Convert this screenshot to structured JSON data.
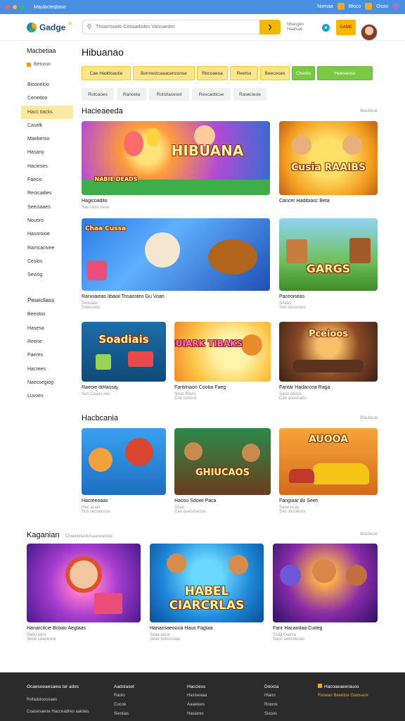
{
  "window": {
    "title": "Maulacteqtaso",
    "controls": [
      "Nomaa",
      "Bloco",
      "Osoo"
    ]
  },
  "header": {
    "logo": "Gadge",
    "logo_sup": "®",
    "search_placeholder": "Thoarroiads Cetaiadsiles Vansaeder",
    "help_lines": [
      "Nbacgeo",
      "Haatsae"
    ],
    "promo": "GAME"
  },
  "sidebar": {
    "head": "Macbetiaa",
    "recent": "Benzoo",
    "items": [
      "Biconeloo",
      "Cenedoo",
      "Hacc tiacks",
      "Caselk",
      "Maeberoo",
      "Hasany",
      "Hacieses",
      "Faecis",
      "Reoicadies",
      "Seeciaaes",
      "Nouoro",
      "Hasoroioe",
      "Ramcacivee",
      "Ceslos",
      "Seviog"
    ],
    "active_index": 2,
    "sub_head": "Pesecliass",
    "sub_items": [
      "Beeotos",
      "Hasesa",
      "Reene",
      "Paeres",
      "Hacrees",
      "Naecsegiog",
      "Luvoes"
    ]
  },
  "main": {
    "title": "Hibuanao",
    "chips": [
      "Cae Haddoaotie",
      "Bonnestcaaacenconse",
      "Rbcoaeoa",
      "Reetsa",
      "Beeceoes",
      "Cherbs",
      "Heleseoss"
    ],
    "tabs": [
      "Rotcaoes",
      "Ranceta",
      "Rotsitacesot",
      "Rescaoticse",
      "Rasecieoe"
    ],
    "sections": [
      {
        "title": "Hacieaeeda",
        "view_all": "Wasbeoe",
        "cards": [
          {
            "title": "Hagicoadlio",
            "meta": "Sax ceos cesa",
            "art": "HIBUANA",
            "art2": "NABIE DEADS"
          },
          {
            "title": "Cancer Hadibiasc Beta",
            "meta": "",
            "art": "Cusia RAAIBS"
          },
          {
            "title": "Ranioaieas libaoil Tosaosteo Gu Voan",
            "meta": "Sxocaas\nSxbocoos",
            "art": "Chaa Cussa"
          },
          {
            "title": "Paceoiseas",
            "meta": "Soaao\nSxo cesocoos",
            "art": "GARGS"
          },
          {
            "title": "Raeoie diHaosaj",
            "meta": "Sus Ceaos ees",
            "art": "Soadiais"
          },
          {
            "title": "Fantilnaon Cooba Faeg",
            "meta": "Sxoo Ravio\nCoo cosoos",
            "art": "GUIARK TIBAKS"
          },
          {
            "title": "Fantar Hadaccoa Raga",
            "meta": "Saoo ceoos\nCao aseocaos",
            "art": "Pceioos"
          }
        ]
      },
      {
        "title": "Hacbcania",
        "view_all": "Wasbeoe",
        "cards": [
          {
            "title": "Hacreeoaas",
            "meta": "Hec asias\nSus secoacoos",
            "art": ""
          },
          {
            "title": "Hacou Sdoiel Paca",
            "meta": "Soao\nCao aseoosecos",
            "art": "GHIUCAOS"
          },
          {
            "title": "Fangiaar do Seen",
            "meta": "Saoo ecas\nSxo socoecos",
            "art": "AUOOA"
          }
        ]
      },
      {
        "title": "Kaganian",
        "subtitle": "Cloaeioitauliosaaceaorae",
        "view_all": "Wasbeoe",
        "cards": [
          {
            "title": "Hanarcitcie Bcbao Aegtaas",
            "meta": "Sabo aeor\nSeoe saaoesoe",
            "art": ""
          },
          {
            "title": "Hanaosaeoooa Haus Fagtaa",
            "meta": "Sxaa aeca\nSeas sceccsoas",
            "art": "HABEL CIARCRLAS"
          },
          {
            "title": "Fanr Hacaodaa Cuiteg",
            "meta": "Sxaa Ooeca\nSaoo aeecoeoas",
            "art": ""
          }
        ]
      }
    ]
  },
  "footer": {
    "cols": [
      {
        "head": "Ocaesoeaesaiea tar ades",
        "lines": [
          "Rofadsioosoaes",
          "Coasesaeoe Hacceadreo aaioias"
        ]
      },
      {
        "head": "Aadoiaset",
        "lines": [
          "Raoio",
          "Cucoe",
          "Sieoiias"
        ]
      },
      {
        "head": "Hacciess",
        "lines": [
          "Hasiseaaa",
          "Aaaeiees",
          "Hasiares"
        ]
      },
      {
        "head": "Doocia",
        "lines": [
          "Hiaoo",
          "Roioos",
          "Sixoos"
        ]
      },
      {
        "head": "Hacoaeaeerauos",
        "lines": [
          "Raseao Beeetoe Giaosace"
        ]
      }
    ]
  },
  "colors": {
    "accent": "#f5b700",
    "green": "#7ac943",
    "chrome": "#4a90e2",
    "footer": "#2b2b2b"
  }
}
